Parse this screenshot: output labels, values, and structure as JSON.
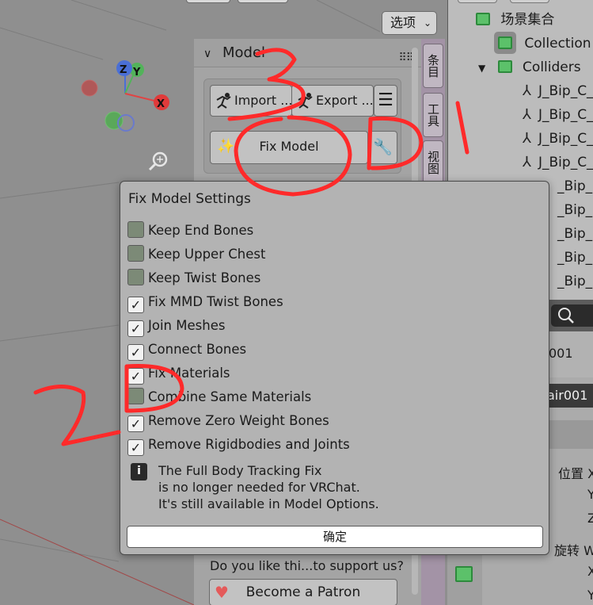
{
  "viewport": {
    "options_label": "选项",
    "gizmo": {
      "x": "X",
      "y": "Y",
      "z": "Z"
    }
  },
  "panel": {
    "title": "Model",
    "import_label": "Import ...",
    "export_label": "Export ...",
    "fix_model_label": "Fix Model",
    "support_text": "Do you like thi...to support us?",
    "patron_label": "Become a Patron"
  },
  "side_tabs": [
    "条目",
    "工具",
    "视图"
  ],
  "outliner": {
    "scene_collection": "场景集合",
    "collection": "Collection",
    "colliders": "Colliders",
    "bones": [
      "J_Bip_C_",
      "J_Bip_C_",
      "J_Bip_C_",
      "J_Bip_C_",
      "_Bip_C_",
      "_Bip_C_",
      "_Bip_L_",
      "_Bip_L_",
      "_Bip_L_"
    ]
  },
  "properties": {
    "item_partial": "001",
    "selected_partial": "air001",
    "location_label": "位置 X",
    "y": "Y",
    "z": "Z",
    "rotation_label": "旋转 W",
    "x": "X"
  },
  "popup": {
    "title": "Fix Model Settings",
    "options": [
      {
        "label": "Keep End Bones",
        "checked": false
      },
      {
        "label": "Keep Upper Chest",
        "checked": false
      },
      {
        "label": "Keep Twist Bones",
        "checked": false
      },
      {
        "label": "Fix MMD Twist Bones",
        "checked": true
      },
      {
        "label": "Join Meshes",
        "checked": true
      },
      {
        "label": "Connect Bones",
        "checked": true
      },
      {
        "label": "Fix Materials",
        "checked": true
      },
      {
        "label": "Combine Same Materials",
        "checked": false
      },
      {
        "label": "Remove Zero Weight Bones",
        "checked": true
      },
      {
        "label": "Remove Rigidbodies and Joints",
        "checked": true
      }
    ],
    "info_lines": [
      "The Full Body Tracking Fix",
      "is no longer needed for VRChat.",
      "It's still available in Model Options."
    ],
    "ok_label": "确定"
  },
  "colors": {
    "annotation_red": "#ff2a2a",
    "checkbox_off": "#7c8a77",
    "collection_green": "#5cc16a",
    "side_tab_purple": "#a393a6"
  }
}
